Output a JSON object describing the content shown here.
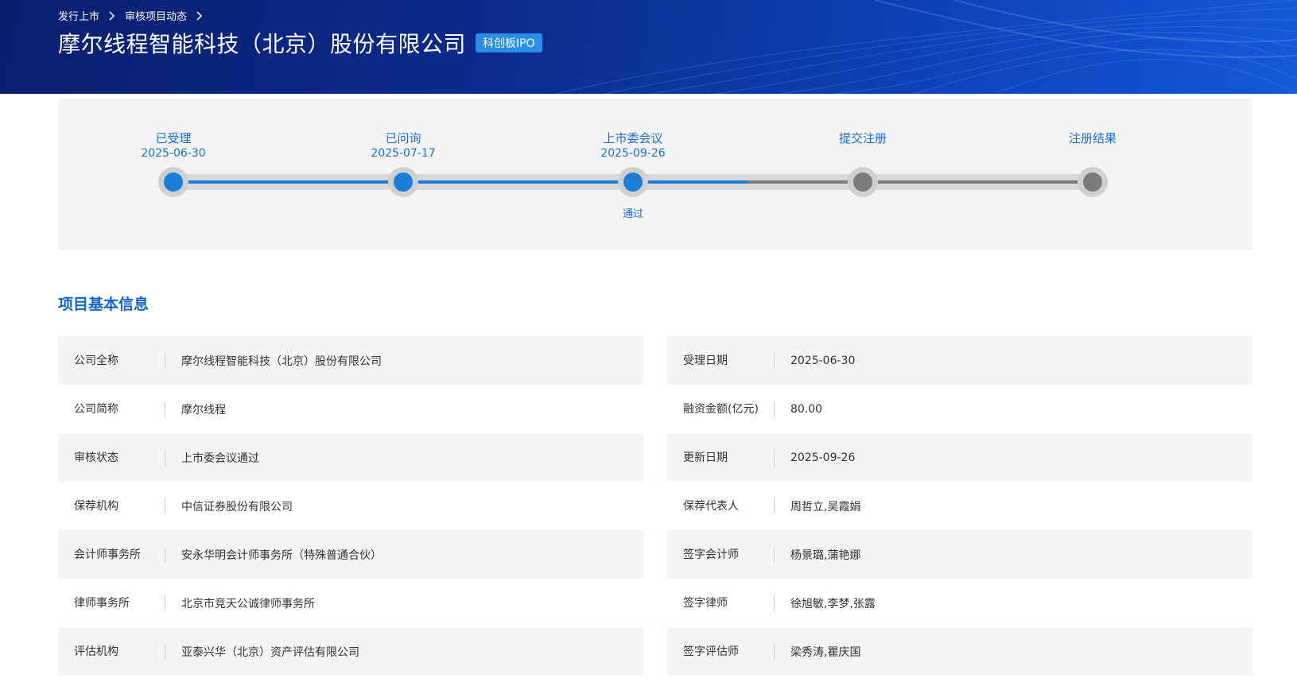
{
  "breadcrumb": {
    "items": [
      "发行上市",
      "审核项目动态"
    ]
  },
  "header": {
    "title": "摩尔线程智能科技（北京）股份有限公司",
    "badge": "科创板IPO"
  },
  "progress": {
    "active_color": "#1a7ed8",
    "inactive_color": "#7a7a7a",
    "steps": [
      {
        "label": "已受理",
        "date": "2025-06-30",
        "note": "",
        "active": true
      },
      {
        "label": "已问询",
        "date": "2025-07-17",
        "note": "",
        "active": true
      },
      {
        "label": "上市委会议",
        "date": "2025-09-26",
        "note": "通过",
        "active": true
      },
      {
        "label": "提交注册",
        "date": "",
        "note": "",
        "active": false
      },
      {
        "label": "注册结果",
        "date": "",
        "note": "",
        "active": false
      }
    ]
  },
  "section": {
    "title": "项目基本信息"
  },
  "info": {
    "rows": [
      {
        "left_label": "公司全称",
        "left_value": "摩尔线程智能科技（北京）股份有限公司",
        "right_label": "受理日期",
        "right_value": "2025-06-30"
      },
      {
        "left_label": "公司简称",
        "left_value": "摩尔线程",
        "right_label": "融资金额(亿元)",
        "right_value": "80.00"
      },
      {
        "left_label": "审核状态",
        "left_value": "上市委会议通过",
        "right_label": "更新日期",
        "right_value": "2025-09-26"
      },
      {
        "left_label": "保荐机构",
        "left_value": "中信证券股份有限公司",
        "right_label": "保荐代表人",
        "right_value": "周哲立,吴霞娟"
      },
      {
        "left_label": "会计师事务所",
        "left_value": "安永华明会计师事务所（特殊普通合伙）",
        "right_label": "签字会计师",
        "right_value": "杨景璐,蒲艳娜"
      },
      {
        "left_label": "律师事务所",
        "left_value": "北京市竞天公诚律师事务所",
        "right_label": "签字律师",
        "right_value": "徐旭敏,李梦,张露"
      },
      {
        "left_label": "评估机构",
        "left_value": "亚泰兴华（北京）资产评估有限公司",
        "right_label": "签字评估师",
        "right_value": "梁秀涛,瞿庆国"
      }
    ]
  }
}
